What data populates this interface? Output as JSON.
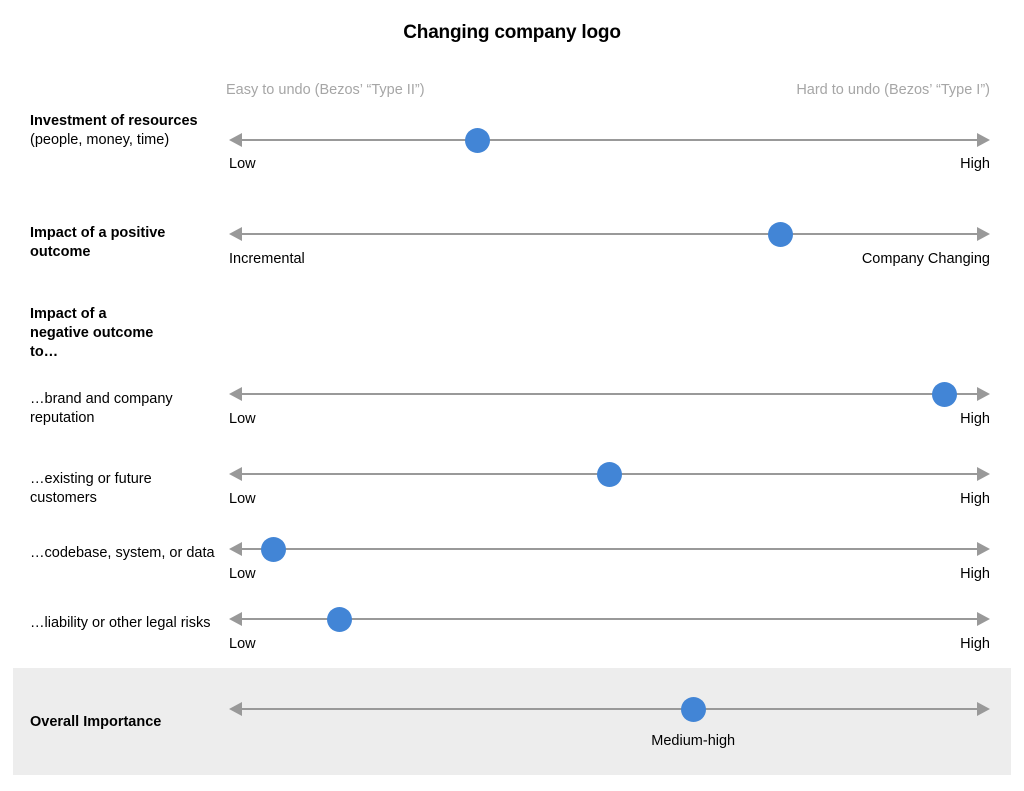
{
  "title": "Changing company logo",
  "scale_header": {
    "left": "Easy to undo (Bezos’ “Type II”)",
    "right": "Hard to undo (Bezos’ “Type I”)"
  },
  "colors": {
    "marker": "#4285d6",
    "track": "#999999",
    "header_text": "#a6a6a6",
    "band_background": "#ededed"
  },
  "chart_data": {
    "type": "bar",
    "title": "Changing company logo",
    "xlabel": "",
    "ylabel": "",
    "axis_header_left": "Easy to undo (Bezos’ “Type II”)",
    "axis_header_right": "Hard to undo (Bezos’ “Type I”)",
    "xlim": [
      0,
      100
    ],
    "grid": false,
    "legend": "none",
    "categories": [
      "Investment of resources (people, money, time)",
      "Impact of a positive outcome",
      "…brand and company reputation",
      "…existing or future customers",
      "…codebase, system, or data",
      "…liability or other legal risks",
      "Overall Importance"
    ],
    "values": [
      32.6,
      72.5,
      94.0,
      50.0,
      5.8,
      14.5,
      61.0
    ]
  },
  "rows": [
    {
      "label_bold": "Investment of resources",
      "label_regular": "(people, money, time)",
      "left_label": "Low",
      "right_label": "High",
      "value": 32.6
    },
    {
      "label_bold": "Impact of a positive outcome",
      "label_regular": "",
      "left_label": "Incremental",
      "right_label": "Company Changing",
      "value": 72.5
    },
    {
      "label_bold": "…brand and company reputation",
      "label_regular": "",
      "left_label": "Low",
      "right_label": "High",
      "value": 94.0
    },
    {
      "label_bold": "…existing or future customers",
      "label_regular": "",
      "left_label": "Low",
      "right_label": "High",
      "value": 50.0
    },
    {
      "label_bold": "…codebase, system, or data",
      "label_regular": "",
      "left_label": "Low",
      "right_label": "High",
      "value": 5.8
    },
    {
      "label_bold": "…liability or other legal risks",
      "label_regular": "",
      "left_label": "Low",
      "right_label": "High",
      "value": 14.5
    }
  ],
  "section_header": {
    "line1": "Impact of a",
    "line2": "negative outcome",
    "line3": "to…"
  },
  "overall": {
    "label": "Overall Importance",
    "value_label": "Medium-high",
    "value": 61.0
  }
}
